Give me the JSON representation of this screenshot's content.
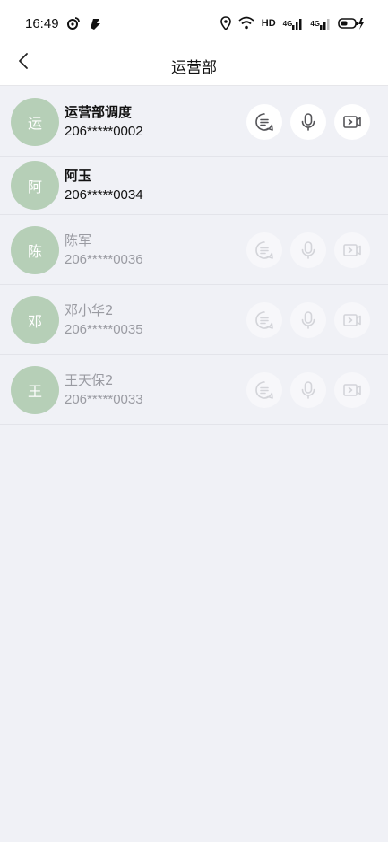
{
  "status_bar": {
    "time": "16:49",
    "network_label": "HD",
    "signal_1": "4G",
    "signal_2": "4G",
    "icons": [
      "weibo-icon",
      "notification-icon",
      "location-icon",
      "wifi-icon",
      "signal-icon",
      "battery-charging-icon"
    ]
  },
  "header": {
    "title": "运营部",
    "back_icon": "chevron-left-icon"
  },
  "contacts": [
    {
      "avatar": "运",
      "name": "运营部调度",
      "phone": "206*****0002",
      "active": true,
      "actions": true
    },
    {
      "avatar": "阿",
      "name": "阿玉",
      "phone": "206*****0034",
      "active": true,
      "actions": false
    },
    {
      "avatar": "陈",
      "name": "陈军",
      "phone": "206*****0036",
      "active": false,
      "actions": true
    },
    {
      "avatar": "邓",
      "name": "邓小华2",
      "phone": "206*****0035",
      "active": false,
      "actions": true
    },
    {
      "avatar": "王",
      "name": "王天保2",
      "phone": "206*****0033",
      "active": false,
      "actions": true
    }
  ],
  "action_icons": [
    "message-icon",
    "microphone-icon",
    "video-call-icon"
  ],
  "colors": {
    "background": "#f0f1f6",
    "avatar": "#b6cfb7",
    "muted_text": "#9a9ba2",
    "active_icon": "#555559",
    "muted_icon": "#d3d4d9"
  }
}
